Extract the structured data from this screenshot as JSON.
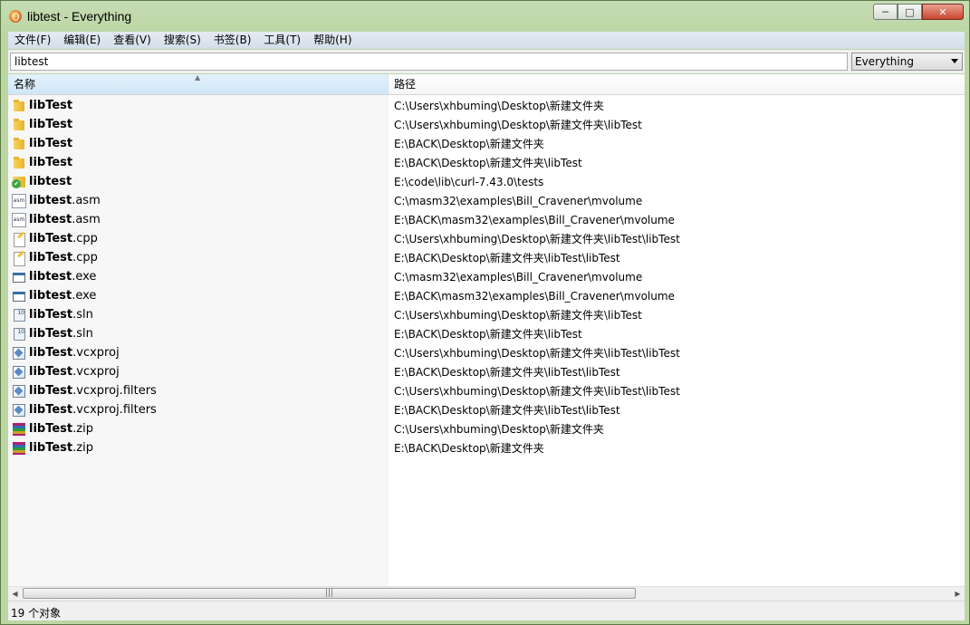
{
  "window": {
    "title": "libtest - Everything"
  },
  "menu": [
    "文件(F)",
    "编辑(E)",
    "查看(V)",
    "搜索(S)",
    "书签(B)",
    "工具(T)",
    "帮助(H)"
  ],
  "search": {
    "value": "libtest",
    "filter": "Everything"
  },
  "columns": {
    "name": "名称",
    "path": "路径"
  },
  "rows": [
    {
      "icon": "folder-icon",
      "bold": "libTest",
      "rest": "",
      "path": "C:\\Users\\xhbuming\\Desktop\\新建文件夹"
    },
    {
      "icon": "folder-icon",
      "bold": "libTest",
      "rest": "",
      "path": "C:\\Users\\xhbuming\\Desktop\\新建文件夹\\libTest"
    },
    {
      "icon": "folder-icon",
      "bold": "libTest",
      "rest": "",
      "path": "E:\\BACK\\Desktop\\新建文件夹"
    },
    {
      "icon": "folder-icon",
      "bold": "libTest",
      "rest": "",
      "path": "E:\\BACK\\Desktop\\新建文件夹\\libTest"
    },
    {
      "icon": "folder-check-icon",
      "bold": "libtest",
      "rest": "",
      "path": "E:\\code\\lib\\curl-7.43.0\\tests"
    },
    {
      "icon": "asm-file-icon",
      "bold": "libtest",
      "rest": ".asm",
      "path": "C:\\masm32\\examples\\Bill_Cravener\\mvolume"
    },
    {
      "icon": "asm-file-icon",
      "bold": "libtest",
      "rest": ".asm",
      "path": "E:\\BACK\\masm32\\examples\\Bill_Cravener\\mvolume"
    },
    {
      "icon": "cpp-file-icon",
      "bold": "libTest",
      "rest": ".cpp",
      "path": "C:\\Users\\xhbuming\\Desktop\\新建文件夹\\libTest\\libTest"
    },
    {
      "icon": "cpp-file-icon",
      "bold": "libTest",
      "rest": ".cpp",
      "path": "E:\\BACK\\Desktop\\新建文件夹\\libTest\\libTest"
    },
    {
      "icon": "exe-file-icon",
      "bold": "libtest",
      "rest": ".exe",
      "path": "C:\\masm32\\examples\\Bill_Cravener\\mvolume"
    },
    {
      "icon": "exe-file-icon",
      "bold": "libtest",
      "rest": ".exe",
      "path": "E:\\BACK\\masm32\\examples\\Bill_Cravener\\mvolume"
    },
    {
      "icon": "sln-file-icon",
      "bold": "libTest",
      "rest": ".sln",
      "path": "C:\\Users\\xhbuming\\Desktop\\新建文件夹\\libTest"
    },
    {
      "icon": "sln-file-icon",
      "bold": "libTest",
      "rest": ".sln",
      "path": "E:\\BACK\\Desktop\\新建文件夹\\libTest"
    },
    {
      "icon": "vcxproj-file-icon",
      "bold": "libTest",
      "rest": ".vcxproj",
      "path": "C:\\Users\\xhbuming\\Desktop\\新建文件夹\\libTest\\libTest"
    },
    {
      "icon": "vcxproj-file-icon",
      "bold": "libTest",
      "rest": ".vcxproj",
      "path": "E:\\BACK\\Desktop\\新建文件夹\\libTest\\libTest"
    },
    {
      "icon": "vcxproj-file-icon",
      "bold": "libTest",
      "rest": ".vcxproj.filters",
      "path": "C:\\Users\\xhbuming\\Desktop\\新建文件夹\\libTest\\libTest"
    },
    {
      "icon": "vcxproj-file-icon",
      "bold": "libTest",
      "rest": ".vcxproj.filters",
      "path": "E:\\BACK\\Desktop\\新建文件夹\\libTest\\libTest"
    },
    {
      "icon": "zip-file-icon",
      "bold": "libTest",
      "rest": ".zip",
      "path": "C:\\Users\\xhbuming\\Desktop\\新建文件夹"
    },
    {
      "icon": "zip-file-icon",
      "bold": "libTest",
      "rest": ".zip",
      "path": "E:\\BACK\\Desktop\\新建文件夹"
    }
  ],
  "status": {
    "text": "19 个对象"
  }
}
